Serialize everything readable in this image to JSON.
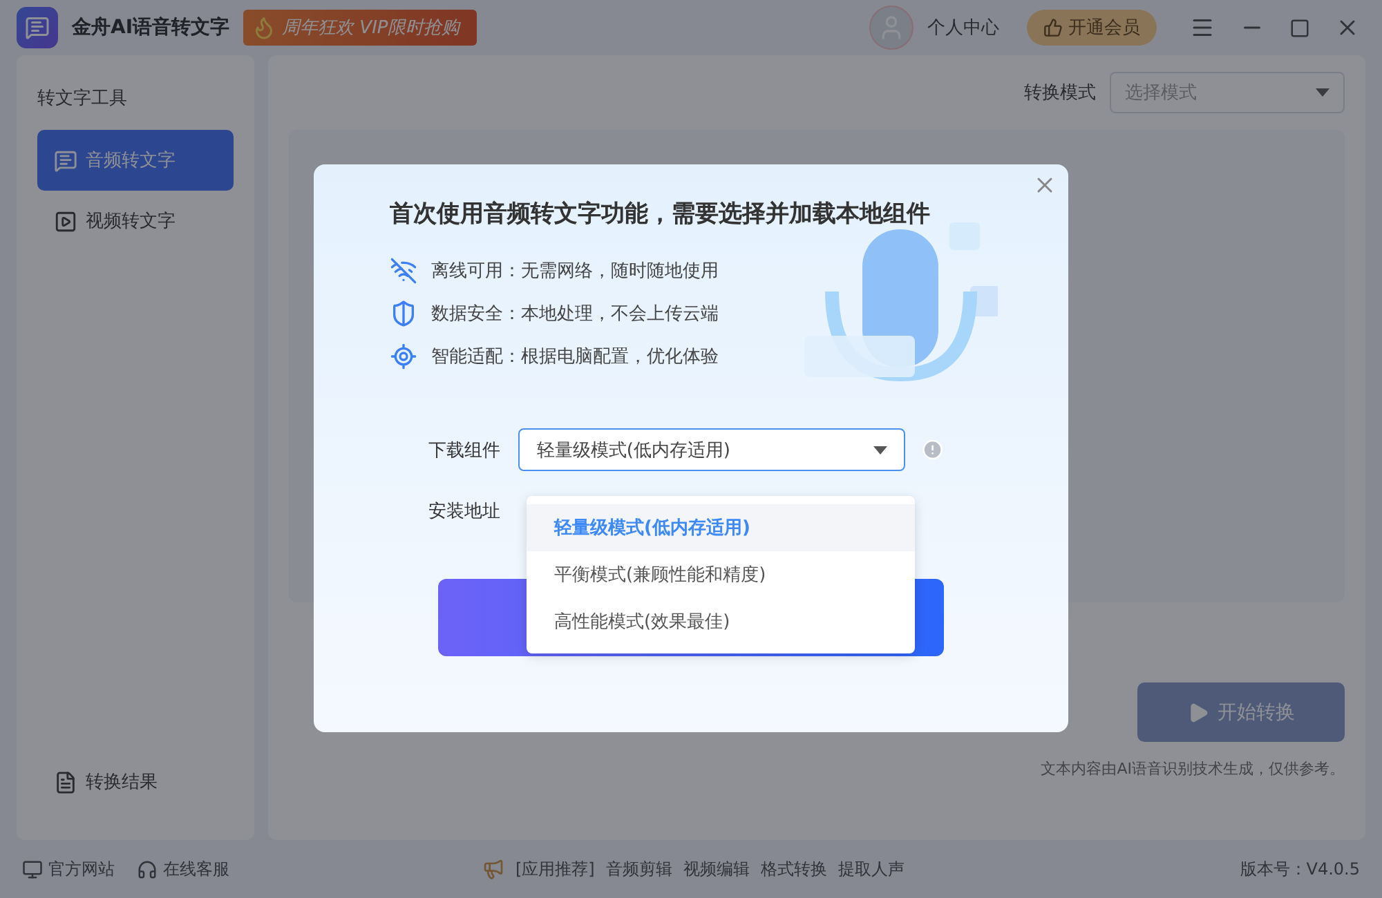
{
  "titlebar": {
    "app_name": "金舟AI语音转文字",
    "promo": "周年狂欢 VIP限时抢购",
    "user": "个人中心",
    "vip": "开通会员"
  },
  "sidebar": {
    "heading": "转文字工具",
    "items": [
      {
        "kind": "audio",
        "label": "音频转文字",
        "selected": true
      },
      {
        "kind": "video",
        "label": "视频转文字",
        "selected": false
      }
    ],
    "result": "转换结果"
  },
  "main": {
    "mode_label": "转换模式",
    "mode_placeholder": "选择模式",
    "start_button": "开始转换",
    "disclaimer": "文本内容由AI语音识别技术生成，仅供参考。"
  },
  "footer": {
    "links": [
      {
        "kind": "site",
        "label": "官方网站"
      },
      {
        "kind": "support",
        "label": "在线客服"
      }
    ],
    "recommend": "[应用推荐]",
    "apps": [
      "音频剪辑",
      "视频编辑",
      "格式转换",
      "提取人声"
    ],
    "version": "版本号：V4.0.5"
  },
  "dialog": {
    "title": "首次使用音频转文字功能，需要选择并加载本地组件",
    "features": [
      {
        "kind": "offline",
        "text": "离线可用：无需网络，随时随地使用"
      },
      {
        "kind": "security",
        "text": "数据安全：本地处理，不会上传云端"
      },
      {
        "kind": "adapt",
        "text": "智能适配：根据电脑配置，优化体验"
      }
    ],
    "component_label": "下载组件",
    "component_value": "轻量级模式(低内存适用)",
    "install_label": "安装地址",
    "options": [
      {
        "label": "轻量级模式(低内存适用)",
        "selected": true
      },
      {
        "label": "平衡模式(兼顾性能和精度)",
        "selected": false
      },
      {
        "label": "高性能模式(效果最佳)",
        "selected": false
      }
    ]
  }
}
